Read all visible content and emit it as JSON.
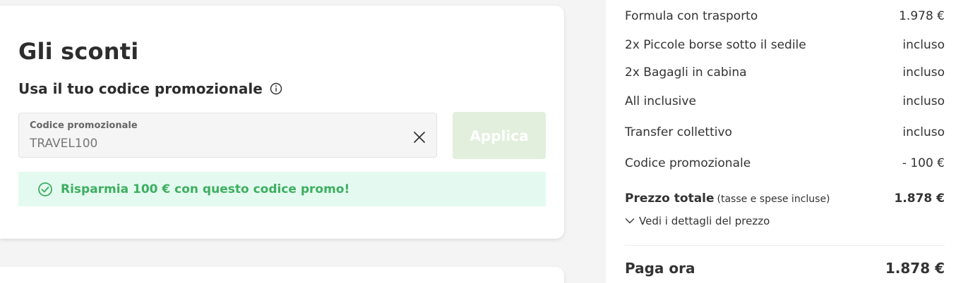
{
  "discounts": {
    "title": "Gli sconti",
    "promo_heading": "Usa il tuo codice promozionale",
    "field_label": "Codice promozionale",
    "field_value": "TRAVEL100",
    "apply_label": "Applica",
    "success_message": "Risparmia 100 € con questo codice promo!"
  },
  "summary": {
    "items": [
      {
        "label": "Formula con trasporto",
        "value": "1.978 €"
      },
      {
        "label": "2x Piccole borse sotto il sedile",
        "value": "incluso"
      },
      {
        "label": "2x Bagagli in cabina",
        "value": "incluso"
      },
      {
        "label": "All inclusive",
        "value": "incluso"
      },
      {
        "label": "Transfer collettivo",
        "value": "incluso"
      },
      {
        "label": "Codice promozionale",
        "value": "- 100 €"
      }
    ],
    "total_label": "Prezzo totale",
    "total_note": "(tasse e spese incluse)",
    "total_value": "1.878 €",
    "details_link": "Vedi i dettagli del prezzo",
    "pay_label": "Paga ora",
    "pay_value": "1.878 €"
  },
  "colors": {
    "success_text": "#3dae5f",
    "success_bg": "#e4faf1",
    "apply_disabled_bg": "#e2efdc"
  }
}
